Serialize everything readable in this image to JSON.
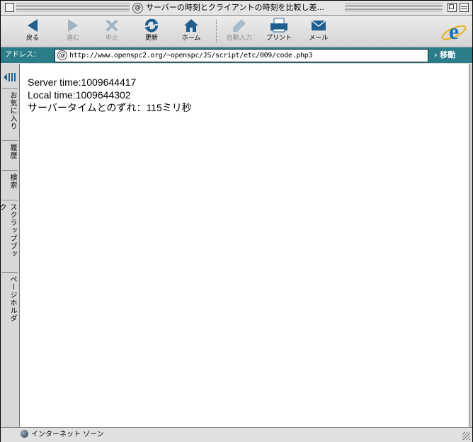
{
  "window": {
    "title": "サーバーの時刻とクライアントの時刻を比較し差...",
    "title_icon": "@"
  },
  "toolbar": {
    "buttons": [
      {
        "label": "戻る",
        "icon": "back-arrow-icon",
        "enabled": true
      },
      {
        "label": "進む",
        "icon": "forward-arrow-icon",
        "enabled": false
      },
      {
        "label": "中止",
        "icon": "stop-x-icon",
        "enabled": false
      },
      {
        "label": "更新",
        "icon": "refresh-icon",
        "enabled": true
      },
      {
        "label": "ホーム",
        "icon": "home-icon",
        "enabled": true
      },
      {
        "label": "自動入力",
        "icon": "autofill-pen-icon",
        "enabled": false
      },
      {
        "label": "プリント",
        "icon": "printer-icon",
        "enabled": true
      },
      {
        "label": "メール",
        "icon": "mail-envelope-icon",
        "enabled": true
      }
    ]
  },
  "address": {
    "label": "アドレス：",
    "icon": "@",
    "url": "http://www.openspc2.org/~openspc/JS/script/etc/009/code.php3",
    "go_label": "› 移動"
  },
  "explorer_tabs": [
    "お気に入り",
    "履歴",
    "検索",
    "スクラップブック",
    "ページホルダ"
  ],
  "page": {
    "lines": [
      "Server time:1009644417",
      "Local time:1009644302",
      "サーバータイムとのずれ：115ミリ秒"
    ]
  },
  "status": {
    "zone": "インターネット ゾーン"
  },
  "colors": {
    "address_bar": "#2c7d8a",
    "toolbar_icon": "#1f5f8f"
  }
}
